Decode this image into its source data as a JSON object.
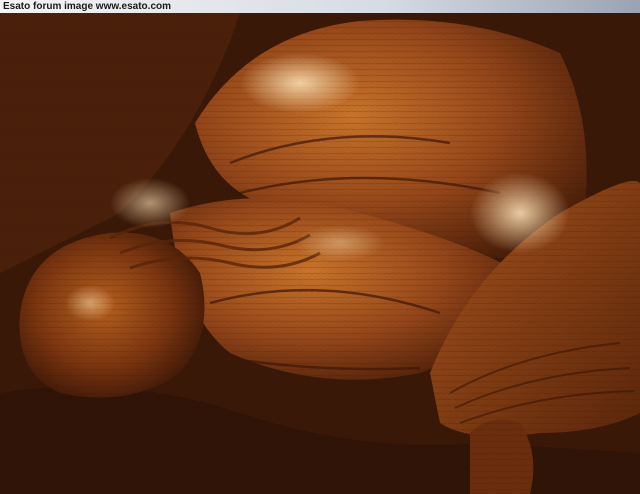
{
  "watermark": {
    "text": "Esato forum image www.esato.com"
  },
  "photo": {
    "subject": "polished-wood-carving-relief",
    "colors": {
      "dark": "#2a1206",
      "mid": "#7a3a12",
      "warm": "#b8621f",
      "highlight": "#f0d2a0"
    }
  }
}
